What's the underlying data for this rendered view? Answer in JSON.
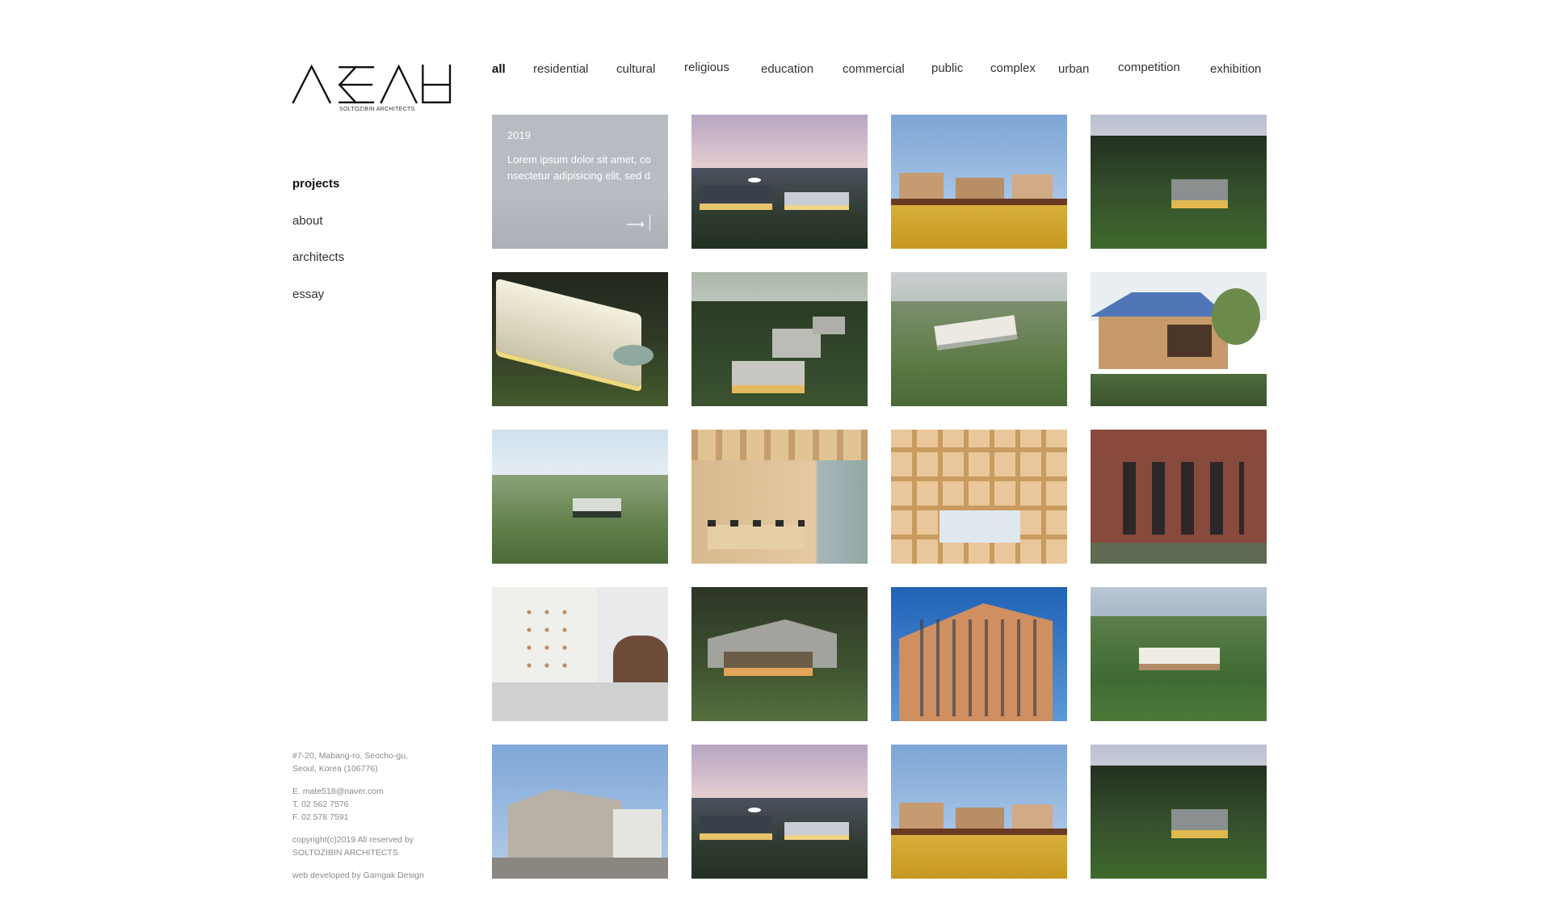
{
  "logo": {
    "icon": "soltozibin-logo-mark",
    "subtitle": "SOLTOZIBIN ARCHITECTS"
  },
  "sidebar": {
    "items": [
      {
        "label": "projects",
        "active": true
      },
      {
        "label": "about",
        "active": false
      },
      {
        "label": "architects",
        "active": false
      },
      {
        "label": "essay",
        "active": false
      }
    ]
  },
  "contact": {
    "address_line1": "#7-20, Mabang-ro, Seocho-gu,",
    "address_line2": "Seoul, Korea (106776)",
    "email": "E. mate518@naver.com",
    "tel": "T. 02 562 7576",
    "fax": "F. 02 578 7591",
    "copyright_line1": "copyright(c)2019 All reserved by",
    "copyright_line2": "SOLTOZIBIN ARCHITECTS",
    "credit": "web developed by Gamgak Design"
  },
  "filters": [
    {
      "label": "all",
      "active": true
    },
    {
      "label": "residential",
      "active": false
    },
    {
      "label": "cultural",
      "active": false
    },
    {
      "label": "religious",
      "active": false
    },
    {
      "label": "education",
      "active": false
    },
    {
      "label": "commercial",
      "active": false
    },
    {
      "label": "public",
      "active": false
    },
    {
      "label": "complex",
      "active": false
    },
    {
      "label": "urban",
      "active": false
    },
    {
      "label": "competition",
      "active": false
    },
    {
      "label": "exhibition",
      "active": false
    }
  ],
  "hover_card": {
    "year": "2019",
    "description": "Lorem ipsum dolor sit amet, consectetur adipisicing elit, sed d",
    "arrow_icon": "arrow-right-icon"
  },
  "projects": [
    {
      "kind": "hover-card"
    },
    {
      "kind": "campus-dusk"
    },
    {
      "kind": "houses-field"
    },
    {
      "kind": "forest-house"
    },
    {
      "kind": "white-pavilion"
    },
    {
      "kind": "hillside-houses"
    },
    {
      "kind": "hill-hotel"
    },
    {
      "kind": "blue-roof-house"
    },
    {
      "kind": "green-campus"
    },
    {
      "kind": "wood-meeting-room"
    },
    {
      "kind": "timber-frame"
    },
    {
      "kind": "brick-building"
    },
    {
      "kind": "white-tower"
    },
    {
      "kind": "grey-roof-house"
    },
    {
      "kind": "orange-office"
    },
    {
      "kind": "white-school-forest"
    },
    {
      "kind": "stone-house"
    },
    {
      "kind": "campus-dusk"
    },
    {
      "kind": "houses-field"
    },
    {
      "kind": "forest-house"
    }
  ]
}
